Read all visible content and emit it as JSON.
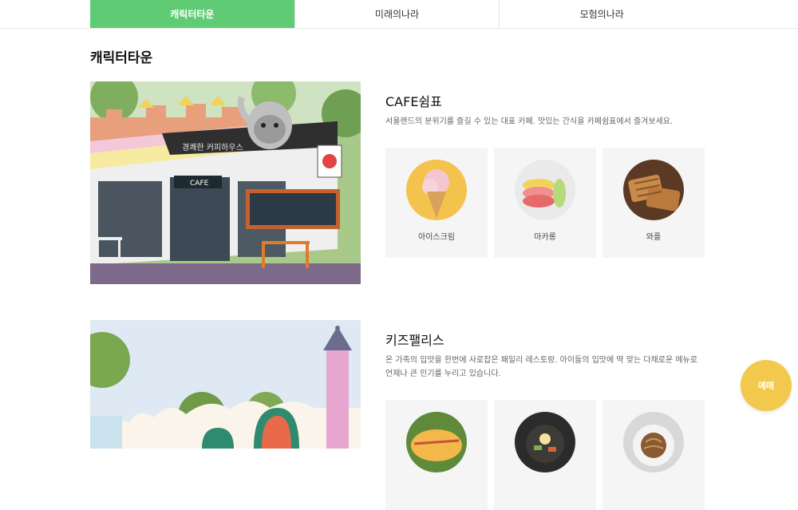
{
  "tabs": [
    {
      "label": "캐릭터타운",
      "active": true
    },
    {
      "label": "미래의나라",
      "active": false
    },
    {
      "label": "모험의나라",
      "active": false
    }
  ],
  "page_title": "캐릭터타운",
  "sections": [
    {
      "title": "CAFE쉼표",
      "description": "서울랜드의 분위기를 즐길 수 있는 대표 카페. 맛있는 간식을 카페쉼표에서 즐겨보세요.",
      "photo_sign_text": "CAFE",
      "photo_banner_text": "경쾌한 커피하우스",
      "items": [
        {
          "label": "아이스크림",
          "icon": "ice-cream-photo"
        },
        {
          "label": "마카롱",
          "icon": "macaron-photo"
        },
        {
          "label": "와플",
          "icon": "waffle-photo"
        }
      ]
    },
    {
      "title": "키즈팰리스",
      "description": "온 가족의 입맛을 한번에 사로잡은 패밀리 레스토랑. 아이들의 입맛에 딱 맞는 다채로운 메뉴로 언제나 큰 인기를 누리고 있습니다.",
      "items": [
        {
          "label": "",
          "icon": "omurice-photo"
        },
        {
          "label": "",
          "icon": "bibimbap-photo"
        },
        {
          "label": "",
          "icon": "pasta-photo"
        }
      ]
    }
  ],
  "reserve_button": "예매",
  "colors": {
    "accent": "#5fcb75",
    "reserve": "#f2c94c",
    "item_bg": "#f5f5f5"
  }
}
